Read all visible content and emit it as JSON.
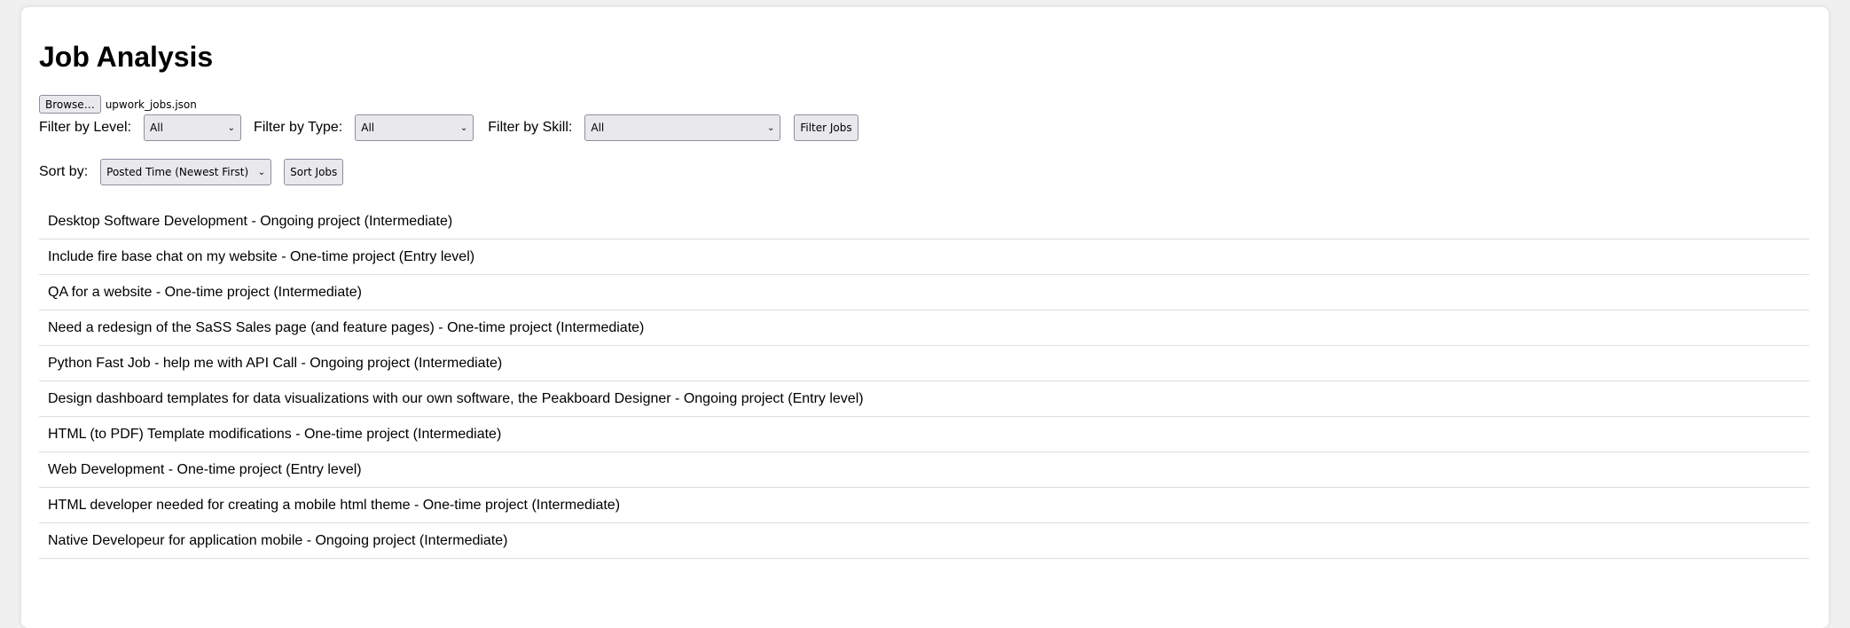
{
  "title": "Job Analysis",
  "file": {
    "button_label": "Browse…",
    "file_name": "upwork_jobs.json"
  },
  "filters": {
    "level_label": "Filter by Level:",
    "level_value": "All",
    "type_label": "Filter by Type:",
    "type_value": "All",
    "skill_label": "Filter by Skill:",
    "skill_value": "All",
    "filter_button": "Filter Jobs"
  },
  "sort": {
    "label": "Sort by:",
    "value": "Posted Time (Newest First)",
    "button": "Sort Jobs"
  },
  "jobs": [
    "Desktop Software Development - Ongoing project (Intermediate)",
    "Include fire base chat on my website - One-time project (Entry level)",
    "QA for a website - One-time project (Intermediate)",
    "Need a redesign of the SaSS Sales page (and feature pages) - One-time project (Intermediate)",
    "Python Fast Job - help me with API Call - Ongoing project (Intermediate)",
    "Design dashboard templates for data visualizations with our own software, the Peakboard Designer - Ongoing project (Entry level)",
    "HTML (to PDF) Template modifications - One-time project (Intermediate)",
    "Web Development - One-time project (Entry level)",
    "HTML developer needed for creating a mobile html theme - One-time project (Intermediate)",
    "Native Developeur for application mobile - Ongoing project (Intermediate)"
  ]
}
